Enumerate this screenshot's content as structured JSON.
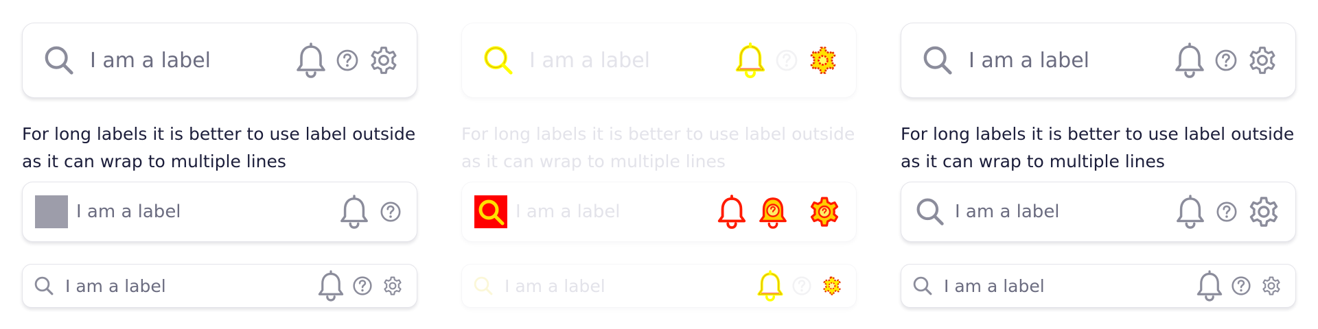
{
  "label_text": "I am a label",
  "helper_text": "For long labels it is better to use label outside as it can wrap to multiple lines",
  "colors": {
    "icon_gray": "#8b8c9b",
    "label_gray": "#6b6c80",
    "note_text": "#1b1d3a",
    "faded_text": "#e3e3ea",
    "highlight_yellow": "#ffff00",
    "highlight_red": "#ff0000",
    "square_gray": "#9d9daa"
  },
  "columns": [
    {
      "variant": "default",
      "large_field": {
        "leading_icon": "search-icon",
        "trailing_icons": [
          "bell-icon",
          "help-icon",
          "gear-icon"
        ]
      },
      "medium_field": {
        "leading_icon": "placeholder-square",
        "trailing_icons": [
          "bell-icon",
          "help-icon"
        ]
      },
      "small_field": {
        "leading_icon": "search-icon",
        "trailing_icons": [
          "bell-icon",
          "help-icon",
          "gear-icon"
        ]
      }
    },
    {
      "variant": "highlighted",
      "large_field": {
        "leading_icon": "search-icon",
        "trailing_icons": [
          "bell-icon",
          "help-icon",
          "gear-icon"
        ]
      },
      "medium_field": {
        "leading_icon": "search-icon",
        "trailing_icons": [
          "bell-icon",
          "bell-help-icon",
          "gear-icon"
        ]
      },
      "small_field": {
        "leading_icon": "search-icon",
        "trailing_icons": [
          "bell-icon",
          "help-icon",
          "gear-icon"
        ]
      }
    },
    {
      "variant": "default",
      "large_field": {
        "leading_icon": "search-icon",
        "trailing_icons": [
          "bell-icon",
          "help-icon",
          "gear-icon"
        ]
      },
      "medium_field": {
        "leading_icon": "search-icon",
        "trailing_icons": [
          "bell-icon",
          "help-icon",
          "gear-icon"
        ]
      },
      "small_field": {
        "leading_icon": "search-icon",
        "trailing_icons": [
          "bell-icon",
          "help-icon",
          "gear-icon"
        ]
      }
    }
  ]
}
